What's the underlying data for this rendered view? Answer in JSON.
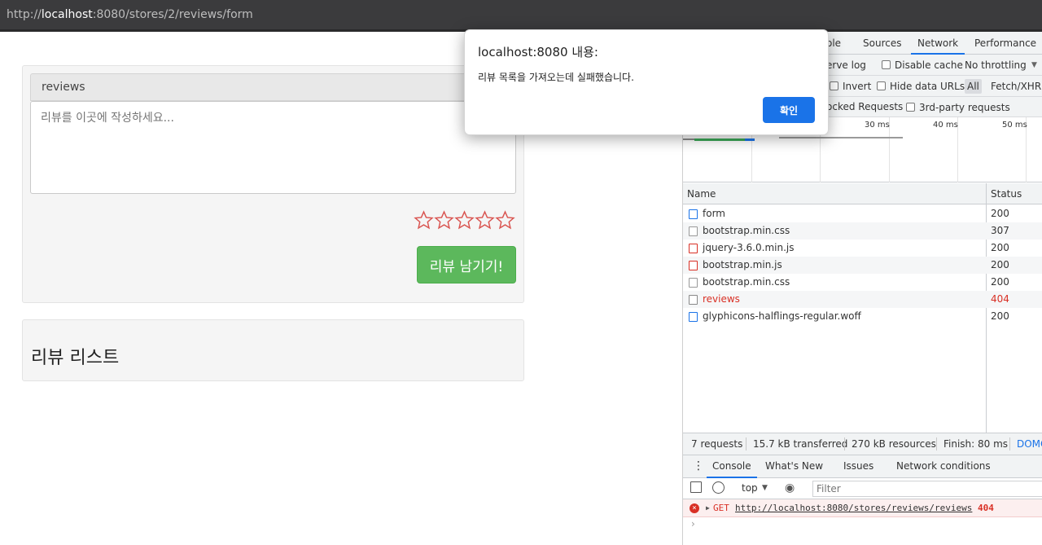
{
  "browser": {
    "url_scheme": "http://",
    "url_host": "localhost",
    "url_rest": ":8080/stores/2/reviews/form"
  },
  "form_panel": {
    "heading": "reviews",
    "textarea_placeholder": "리뷰를 이곳에 작성하세요...",
    "stars": [
      "☆",
      "☆",
      "☆",
      "☆",
      "☆"
    ],
    "submit_label": "리뷰 남기기!"
  },
  "list_panel": {
    "title": "리뷰 리스트"
  },
  "dialog": {
    "title": "localhost:8080 내용:",
    "message": "리뷰 목록을 가져오는데 실패했습니다.",
    "ok_label": "확인"
  },
  "devtools": {
    "tabs": [
      "ole",
      "Sources",
      "Network",
      "Performance"
    ],
    "active_tab": "Network",
    "toolbar1": {
      "preserve_log": "erve log",
      "disable_cache": "Disable cache",
      "throttling": "No throttling"
    },
    "toolbar2": {
      "invert": "Invert",
      "hide_data_urls": "Hide data URLs",
      "all": "All",
      "fetch_xhr": "Fetch/XHR"
    },
    "toolbar3": {
      "blocked": "ocked Requests",
      "third_party": "3rd-party requests"
    },
    "timeline_ticks": [
      "30 ms",
      "40 ms",
      "50 ms"
    ],
    "columns": {
      "name": "Name",
      "status": "Status"
    },
    "requests": [
      {
        "name": "form",
        "status": "200",
        "type": "doc"
      },
      {
        "name": "bootstrap.min.css",
        "status": "307",
        "type": "css"
      },
      {
        "name": "jquery-3.6.0.min.js",
        "status": "200",
        "type": "js"
      },
      {
        "name": "bootstrap.min.js",
        "status": "200",
        "type": "js"
      },
      {
        "name": "bootstrap.min.css",
        "status": "200",
        "type": "css"
      },
      {
        "name": "reviews",
        "status": "404",
        "type": "xhr"
      },
      {
        "name": "glyphicons-halflings-regular.woff",
        "status": "200",
        "type": "font"
      }
    ],
    "summary": {
      "requests": "7 requests",
      "transferred": "15.7 kB transferred",
      "resources": "270 kB resources",
      "finish": "Finish: 80 ms",
      "domc": "DOMC"
    },
    "drawer_tabs": [
      "Console",
      "What's New",
      "Issues",
      "Network conditions"
    ],
    "console": {
      "context": "top",
      "filter_placeholder": "Filter",
      "error_method": "GET",
      "error_url": "http://localhost:8080/stores/reviews/reviews",
      "error_code": "404",
      "prompt": "›"
    }
  },
  "colors": {
    "success": "#5cb85c",
    "devtools_accent": "#1a73e8",
    "error": "#d93025",
    "star": "#d9534f"
  }
}
